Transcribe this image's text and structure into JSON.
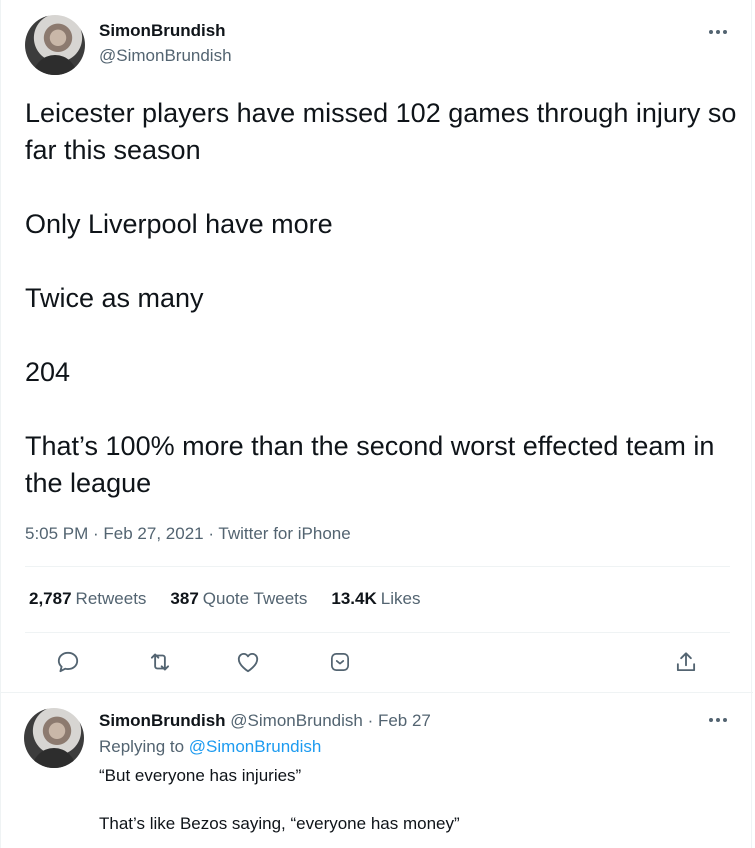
{
  "tweet": {
    "author_name": "SimonBrundish",
    "author_handle": "@SimonBrundish",
    "lines": [
      "Leicester players have missed 102 games through injury so far this season",
      "Only Liverpool have more",
      "Twice as many",
      "204",
      "That’s 100% more than the second worst effected team in the league"
    ],
    "meta": "5:05 PM · Feb 27, 2021 · Twitter for iPhone",
    "stats": {
      "retweets_count": "2,787",
      "retweets_label": "Retweets",
      "quotes_count": "387",
      "quotes_label": "Quote Tweets",
      "likes_count": "13.4K",
      "likes_label": "Likes"
    }
  },
  "reply": {
    "author_name": "SimonBrundish",
    "author_handle": "@SimonBrundish",
    "date": "· Feb 27",
    "replying_to_label": "Replying to",
    "replying_to_handle": "@SimonBrundish",
    "line1": "“But everyone has injuries”",
    "line2": "That’s like Bezos saying, “everyone has money”"
  },
  "icons": [
    "avatar",
    "more-icon",
    "reply-icon",
    "retweet-icon",
    "like-icon",
    "bookmark-icon",
    "share-icon"
  ],
  "colors": {
    "text": "#0f1419",
    "secondary": "#536471",
    "link": "#1d9bf0",
    "divider": "#eff3f4"
  }
}
